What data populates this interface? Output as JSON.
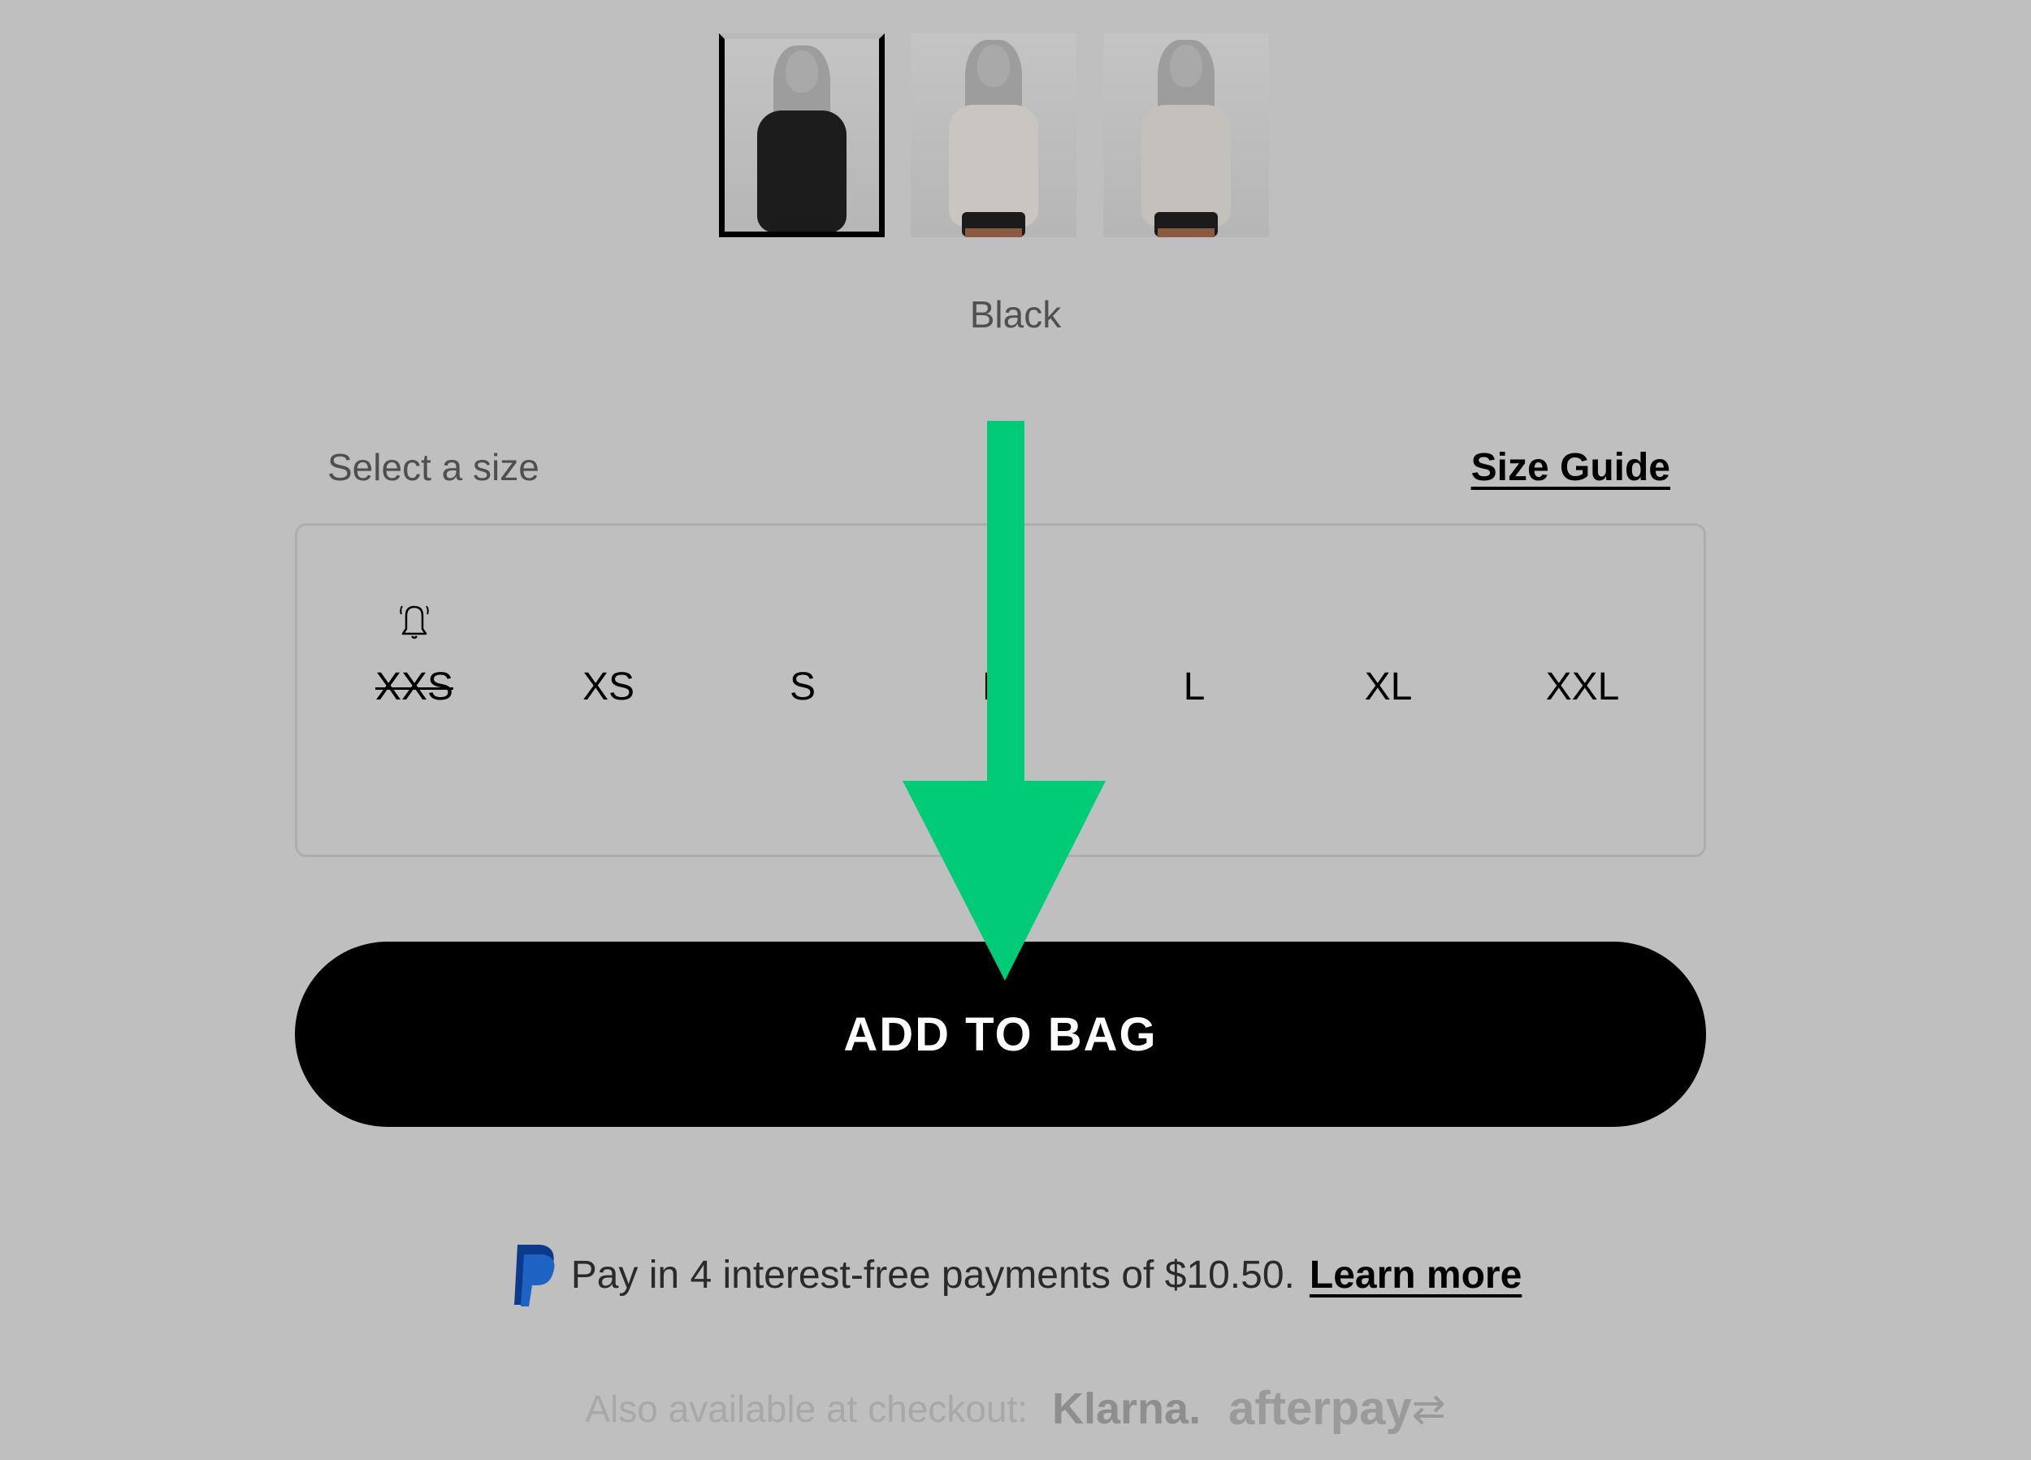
{
  "gallery": {
    "thumbnails": [
      {
        "color": "Black",
        "selected": true,
        "shirt_hex": "#1c1c1c"
      },
      {
        "color": "Light Grey",
        "selected": false,
        "shirt_hex": "#c9c6c2"
      },
      {
        "color": "Light Grey",
        "selected": false,
        "shirt_hex": "#c4c0bb"
      }
    ],
    "selected_color_name": "Black"
  },
  "size_selector": {
    "label": "Select a size",
    "size_guide_label": "Size Guide",
    "sizes": [
      {
        "label": "XXS",
        "available": false,
        "notify_icon": "bell-icon"
      },
      {
        "label": "XS",
        "available": true
      },
      {
        "label": "S",
        "available": true
      },
      {
        "label": "M",
        "available": true
      },
      {
        "label": "L",
        "available": true
      },
      {
        "label": "XL",
        "available": true
      },
      {
        "label": "XXL",
        "available": true
      }
    ]
  },
  "add_to_bag": {
    "label": "ADD TO BAG"
  },
  "annotation": {
    "type": "arrow-down",
    "color": "#00cc77"
  },
  "payments": {
    "paypal_text": "Pay in 4 interest-free payments of $10.50.",
    "learn_more_label": "Learn more",
    "also_available_label": "Also available at checkout:",
    "providers": [
      "Klarna.",
      "afterpay"
    ]
  }
}
